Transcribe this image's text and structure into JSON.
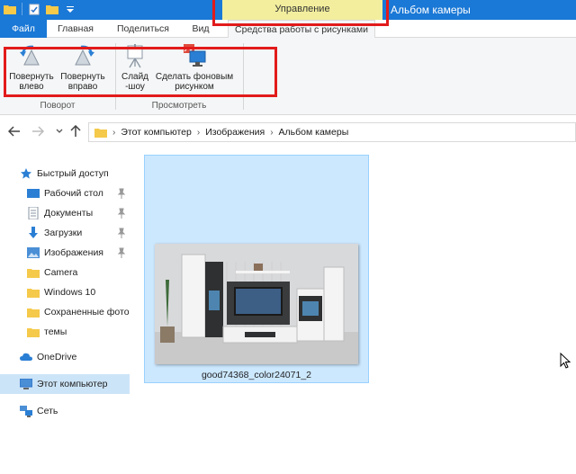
{
  "window": {
    "title": "Альбом камеры",
    "context_tab": "Управление"
  },
  "ribbon_tabs": {
    "file": "Файл",
    "home": "Главная",
    "share": "Поделиться",
    "view": "Вид",
    "picture_tools": "Средства работы с рисунками"
  },
  "ribbon": {
    "rotate_left": [
      "Повернуть",
      "влево"
    ],
    "rotate_right": [
      "Повернуть",
      "вправо"
    ],
    "slideshow": [
      "Слайд",
      "-шоу"
    ],
    "set_background": [
      "Сделать фоновым",
      "рисунком"
    ],
    "group_rotate": "Поворот",
    "group_view": "Просмотреть"
  },
  "address": {
    "crumbs": [
      "Этот компьютер",
      "Изображения",
      "Альбом камеры"
    ]
  },
  "nav": {
    "quick_access": "Быстрый доступ",
    "desktop": "Рабочий стол",
    "documents": "Документы",
    "downloads": "Загрузки",
    "pictures": "Изображения",
    "camera": "Camera",
    "windows10": "Windows 10",
    "saved_photos": "Сохраненные фото",
    "themes": "темы",
    "onedrive": "OneDrive",
    "this_pc": "Этот компьютер",
    "network": "Сеть"
  },
  "files": [
    {
      "name": "good74368_color24071_2"
    }
  ],
  "colors": {
    "accent": "#1a78d6",
    "context_tab": "#f2ee9e",
    "selection": "#cce8ff",
    "annotation": "#e21b1b"
  }
}
